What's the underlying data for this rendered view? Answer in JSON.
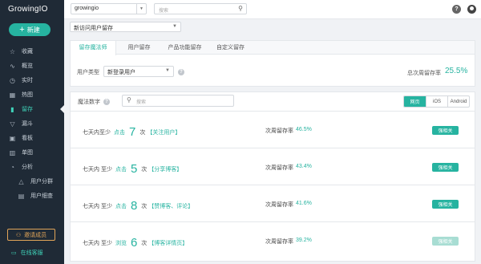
{
  "sidebar": {
    "logo": "GrowingIO",
    "new_button": "新建",
    "items": [
      {
        "icon": "star-icon",
        "glyph": "☆",
        "label": "收藏"
      },
      {
        "icon": "trend-icon",
        "glyph": "∿",
        "label": "概览"
      },
      {
        "icon": "clock-icon",
        "glyph": "◷",
        "label": "实时"
      },
      {
        "icon": "heatmap-icon",
        "glyph": "▦",
        "label": "热图"
      },
      {
        "icon": "retention-icon",
        "glyph": "▮",
        "label": "留存"
      },
      {
        "icon": "funnel-icon",
        "glyph": "▽",
        "label": "漏斗"
      },
      {
        "icon": "dashboard-icon",
        "glyph": "▣",
        "label": "看板"
      },
      {
        "icon": "chart-icon",
        "glyph": "▥",
        "label": "单图"
      },
      {
        "icon": "analysis-icon",
        "glyph": "◔",
        "label": "分析"
      },
      {
        "icon": "segment-icon",
        "glyph": "△",
        "label": "用户分群"
      },
      {
        "icon": "detail-icon",
        "glyph": "▤",
        "label": "用户细查"
      }
    ],
    "invite_button": "邀请成员",
    "service_link": "在线客服",
    "active_color": "#26b3a0"
  },
  "topbar": {
    "project": "growingio",
    "search_placeholder": "搜索"
  },
  "report_select": "新访问用户留存",
  "tabs": [
    "留存魔法师",
    "用户留存",
    "产品功能留存",
    "自定义留存"
  ],
  "filter": {
    "user_type_label": "用户类型",
    "user_type_value": "新登录用户",
    "total_label": "总次周留存率",
    "total_value": "25.5%"
  },
  "magic": {
    "label": "魔法数字",
    "search_placeholder": "搜索",
    "platforms": [
      "网页",
      "iOS",
      "Android"
    ],
    "rows": [
      {
        "prefix": "七天内至少",
        "action": "点击",
        "count": "7",
        "unit": "次",
        "event": "【关注用户】",
        "rate_label": "次周留存率",
        "rate": "46.5%",
        "badge": "强相关"
      },
      {
        "prefix": "七天内 至少",
        "action": "点击",
        "count": "5",
        "unit": "次",
        "event": "【分享博客】",
        "rate_label": "次周留存率",
        "rate": "43.4%",
        "badge": "强相关"
      },
      {
        "prefix": "七天内 至少",
        "action": "点击",
        "count": "8",
        "unit": "次",
        "event": "【赞博客、评论】",
        "rate_label": "次周留存率",
        "rate": "41.6%",
        "badge": "强相关"
      },
      {
        "prefix": "七天内 至少",
        "action": "浏览",
        "count": "6",
        "unit": "次",
        "event": "【博客详情页】",
        "rate_label": "次周留存率",
        "rate": "39.2%",
        "badge": "强相关"
      }
    ]
  }
}
